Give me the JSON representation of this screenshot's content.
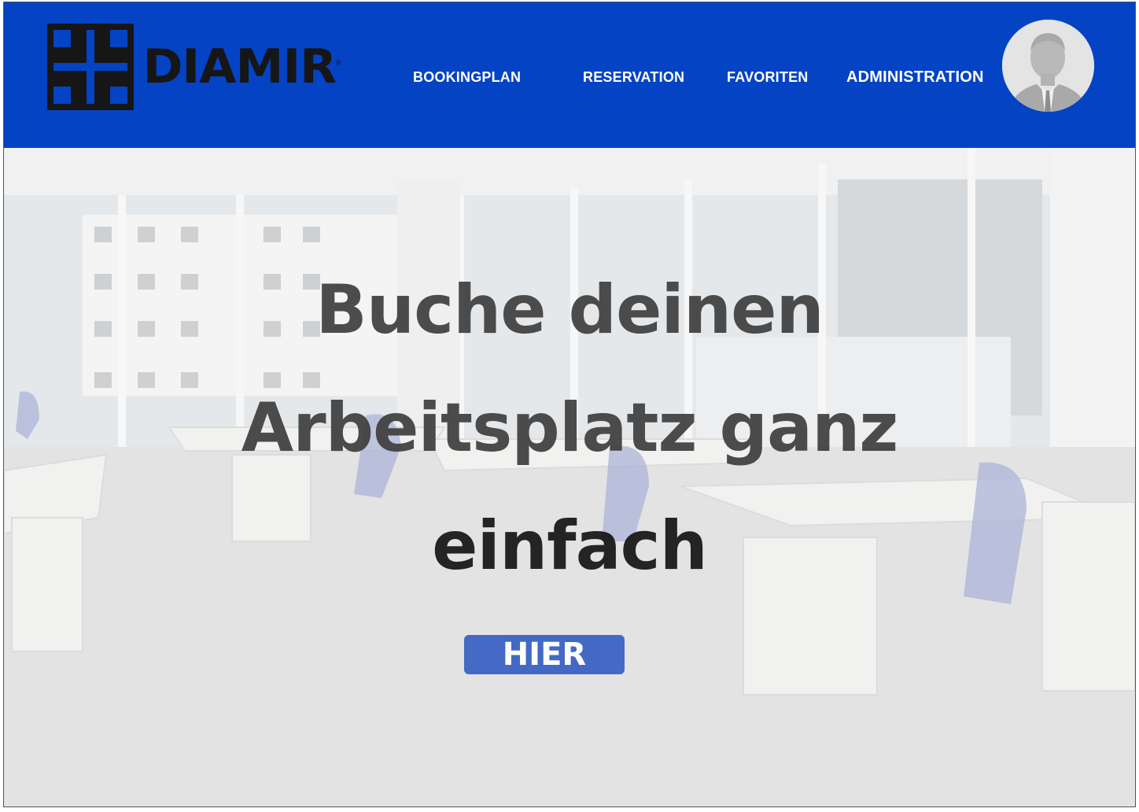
{
  "brand": {
    "name": "DIAMIR",
    "registered_mark": "®",
    "colors": {
      "header": "#0443c4",
      "logo": "#161616",
      "cta": "#3b63c3"
    }
  },
  "nav": {
    "items": [
      {
        "label": "BOOKINGPLAN"
      },
      {
        "label": "RESERVATION"
      },
      {
        "label": "FAVORITEN"
      },
      {
        "label": "ADMINISTRATION"
      }
    ]
  },
  "profile": {
    "icon": "user-avatar-icon"
  },
  "hero": {
    "headline_line1": "Buche deinen",
    "headline_line2": "Arbeitsplatz ganz",
    "headline_line3": "einfach",
    "cta_label": "HIER",
    "background": "office-photo"
  }
}
